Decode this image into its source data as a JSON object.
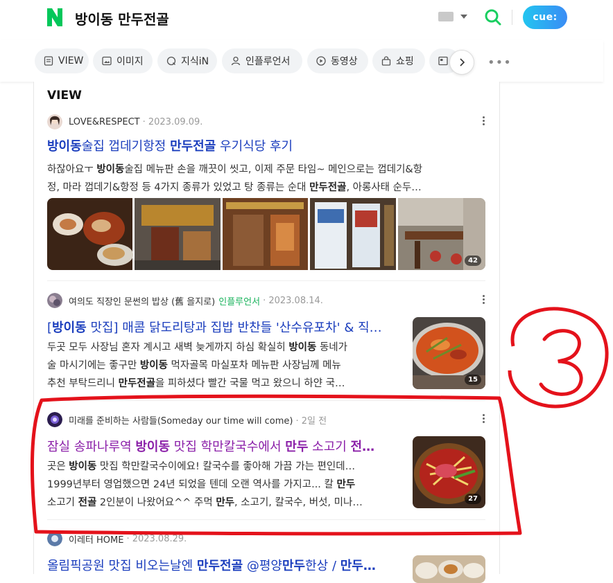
{
  "header": {
    "logo_letter": "N",
    "query": "방이동 만두전골",
    "cue_label": "cue:"
  },
  "tabs": [
    {
      "label": "VIEW",
      "icon": "document-icon"
    },
    {
      "label": "이미지",
      "icon": "image-icon"
    },
    {
      "label": "지식iN",
      "icon": "q-bubble-icon"
    },
    {
      "label": "인플루언서",
      "icon": "person-icon"
    },
    {
      "label": "동영상",
      "icon": "play-icon"
    },
    {
      "label": "쇼핑",
      "icon": "bag-icon"
    },
    {
      "label": "",
      "icon": "news-icon"
    }
  ],
  "section_title": "VIEW",
  "results": [
    {
      "author": "LOVE&RESPECT",
      "influencer": "",
      "date": "· 2023.09.09.",
      "title": [
        [
          "방이동",
          true
        ],
        [
          "술집 껍데기항정 ",
          false
        ],
        [
          "만두전골",
          true
        ],
        [
          " 우기식당 후기",
          false
        ]
      ],
      "desc": [
        [
          [
            "하잖아요ㅜ ",
            false
          ],
          [
            "방이동",
            true
          ],
          [
            "술집 메뉴판 손을 깨끗이 씻고, 이제 주문 타임~ 메인으로는 껍데기&항",
            false
          ]
        ],
        [
          [
            "정, 마라 껍데기&항정 등 4가지 종류가 있었고 탕 종류는 순대 ",
            false
          ],
          [
            "만두전골",
            true
          ],
          [
            ", 아롱사태 순두…",
            false
          ]
        ]
      ],
      "image_count": "42"
    },
    {
      "author": "여의도 직장인 문썬의 밥상 (舊 을지로)",
      "influencer": "인플루언서",
      "date": "· 2023.08.14.",
      "title": [
        [
          "[",
          false
        ],
        [
          "방이동",
          true
        ],
        [
          " 맛집] 매콤 닭도리탕과 집밥 반찬들 '산수유포차' & 직…",
          false
        ]
      ],
      "desc": [
        [
          [
            "두곳 모두 사장님 혼자 계시고 새벽 늦게까지 하심 확실히 ",
            false
          ],
          [
            "방이동",
            true
          ],
          [
            " 동네가",
            false
          ]
        ],
        [
          [
            "술 마시기에는 좋구만 ",
            false
          ],
          [
            "방이동",
            true
          ],
          [
            " 먹자골목 마실포차 메뉴판 사장님께 메뉴",
            false
          ]
        ],
        [
          [
            "추천 부탁드리니 ",
            false
          ],
          [
            "만두전골",
            true
          ],
          [
            "을 피하셨다 빨간 국물 먹고 왔으니 하얀 국…",
            false
          ]
        ]
      ],
      "image_count": "15"
    },
    {
      "author": "미래를 준비하는 사람들(Someday our time will come)",
      "influencer": "",
      "date": "· 2일 전",
      "title": [
        [
          "잠실 송파나루역 ",
          false
        ],
        [
          "방이동",
          true
        ],
        [
          " 맛집 학만칼국수에서 ",
          false
        ],
        [
          "만두",
          true
        ],
        [
          " 소고기 ",
          false
        ],
        [
          "전…",
          true
        ]
      ],
      "desc": [
        [
          [
            "곳은 ",
            false
          ],
          [
            "방이동",
            true
          ],
          [
            " 맛집 학만칼국수이에요! 칼국수를 좋아해 가끔 가는 편인데…",
            false
          ]
        ],
        [
          [
            "1999년부터 영업했으면 24년 되었을 텐데 오랜 역사를 가지고... 칼 ",
            false
          ],
          [
            "만두",
            true
          ]
        ],
        [
          [
            "소고기 ",
            false
          ],
          [
            "전골",
            true
          ],
          [
            " 2인분이 나왔어요^^ 주먹 ",
            false
          ],
          [
            "만두",
            true
          ],
          [
            ", 소고기, 칼국수, 버섯, 미나…",
            false
          ]
        ]
      ],
      "image_count": "27"
    },
    {
      "author": "이레터 HOME",
      "influencer": "",
      "date": "· 2023.08.29.",
      "title": [
        [
          "올림픽공원 맛집 비오는날엔 ",
          false
        ],
        [
          "만두전골",
          true
        ],
        [
          " @평양",
          false
        ],
        [
          "만두",
          true
        ],
        [
          "한상 / ",
          false
        ],
        [
          "만두…",
          true
        ]
      ],
      "desc": [],
      "image_count": ""
    }
  ],
  "annotation": {
    "number": "3",
    "color": "#e4121b"
  },
  "colors": {
    "naver_green": "#19ce60",
    "link_blue": "#1a3dbd",
    "visited_purple": "#8a1ea8"
  }
}
